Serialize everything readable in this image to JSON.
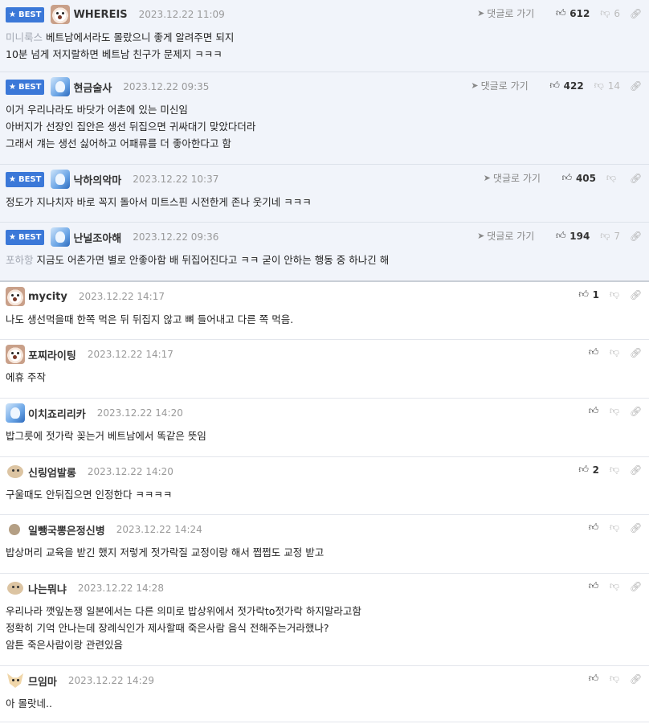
{
  "ui": {
    "best_label": "BEST",
    "reply_label": "댓글로 가기",
    "thumb_up_icon": "thumb-up-icon",
    "thumb_down_icon": "thumb-down-icon",
    "link_icon": "link-icon"
  },
  "best_comments": [
    {
      "nick": "WHEREIS",
      "date": "2023.12.22 11:09",
      "likes": "612",
      "dislikes": "6",
      "prefix": "미니룩스",
      "lines": [
        "베트남에서라도 몰랐으니 좋게 알려주면 되지",
        "10분 넘게 저지랄하면 베트남 친구가 문제지 ㅋㅋㅋ"
      ]
    },
    {
      "nick": "현금술사",
      "date": "2023.12.22 09:35",
      "likes": "422",
      "dislikes": "14",
      "prefix": "",
      "lines": [
        "이거 우리나라도 바닷가 어촌에 있는 미신임",
        "아버지가 선장인 집안은 생선 뒤집으면 귀싸대기 맞았다더라",
        "그래서 걔는 생선 싫어하고 어패류를 더 좋아한다고 함"
      ]
    },
    {
      "nick": "낙하의악마",
      "date": "2023.12.22 10:37",
      "likes": "405",
      "dislikes": "",
      "prefix": "",
      "lines": [
        "정도가 지나치자 바로 꼭지 돌아서 미트스핀 시전한게 존나 웃기네 ㅋㅋㅋ"
      ]
    },
    {
      "nick": "난널조아해",
      "date": "2023.12.22 09:36",
      "likes": "194",
      "dislikes": "7",
      "prefix": "포하항",
      "lines": [
        "지금도 어촌가면 별로 안좋아함 배 뒤집어진다고 ㅋㅋ 굳이 안하는 행동 중 하나긴 해"
      ]
    }
  ],
  "comments": [
    {
      "nick": "mycity",
      "date": "2023.12.22 14:17",
      "likes": "1",
      "dislikes": "",
      "lines": [
        "나도 생선먹을때 한쪽 먹은 뒤 뒤집지 않고 뼈 들어내고 다른 쪽 먹음."
      ]
    },
    {
      "nick": "포찌라이팅",
      "date": "2023.12.22 14:17",
      "likes": "",
      "dislikes": "",
      "lines": [
        "에휴 주작"
      ]
    },
    {
      "nick": "이치죠리리카",
      "date": "2023.12.22 14:20",
      "likes": "",
      "dislikes": "",
      "lines": [
        "밥그릇에 젓가락 꽂는거 베트남에서 똑같은 뜻임"
      ]
    },
    {
      "nick": "신링엄발롱",
      "date": "2023.12.22 14:20",
      "likes": "2",
      "dislikes": "",
      "lines": [
        "구울때도 안뒤집으면 인정한다 ㅋㅋㅋㅋ"
      ]
    },
    {
      "nick": "일뺑국뽕은정신병",
      "date": "2023.12.22 14:24",
      "likes": "",
      "dislikes": "",
      "lines": [
        "밥상머리 교육을 받긴 했지 저렇게 젓가락질 교정이랑 해서 쩝쩝도 교정 받고"
      ]
    },
    {
      "nick": "나는뭐냐",
      "date": "2023.12.22 14:28",
      "likes": "",
      "dislikes": "",
      "lines": [
        "우리나라 깻잎논쟁 일본에서는 다른 의미로 밥상위에서 젓가락to젓가락 하지말라고함",
        "정확히 기억 안나는데 장례식인가 제사할때 죽은사람 음식 전해주는거라했나?",
        "암튼 죽은사람이랑 관련있음"
      ]
    },
    {
      "nick": "므임마",
      "date": "2023.12.22 14:29",
      "likes": "",
      "dislikes": "",
      "lines": [
        "아 몰랏네.."
      ]
    }
  ]
}
